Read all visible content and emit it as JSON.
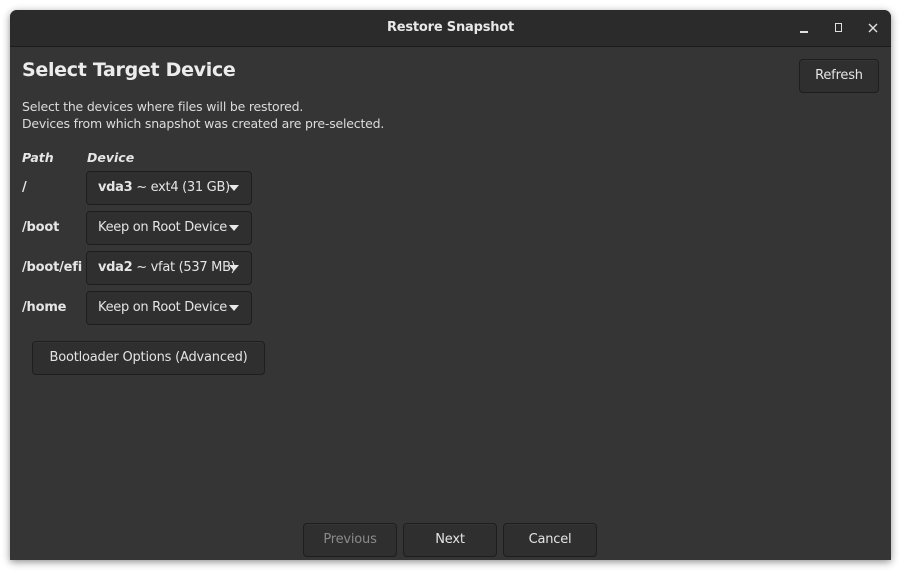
{
  "window": {
    "title": "Restore Snapshot",
    "controls": {
      "minimize": "minimize-icon",
      "maximize": "maximize-icon",
      "close": "close-icon"
    }
  },
  "page": {
    "heading": "Select Target Device",
    "description_line1": "Select the devices where files will be restored.",
    "description_line2": "Devices from which snapshot was created are pre-selected.",
    "refresh_label": "Refresh"
  },
  "table": {
    "headers": {
      "path": "Path",
      "device": "Device"
    },
    "rows": [
      {
        "path": "/",
        "device_name": "vda3",
        "device_detail": " ~ ext4 (31 GB)"
      },
      {
        "path": "/boot",
        "device_name": "",
        "device_detail": "Keep on Root Device"
      },
      {
        "path": "/boot/efi",
        "device_name": "vda2",
        "device_detail": " ~ vfat (537 MB)"
      },
      {
        "path": "/home",
        "device_name": "",
        "device_detail": "Keep on Root Device"
      }
    ]
  },
  "bootloader_button": "Bootloader Options (Advanced)",
  "footer": {
    "previous": "Previous",
    "previous_enabled": false,
    "next": "Next",
    "cancel": "Cancel"
  }
}
